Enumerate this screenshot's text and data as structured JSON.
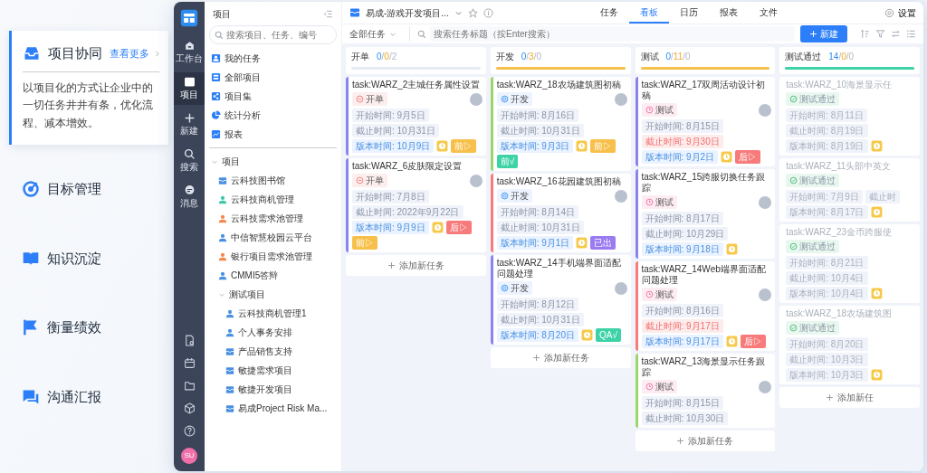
{
  "features": [
    {
      "title": "项目协同",
      "selected": true,
      "link": "查看更多",
      "description": "以项目化的方式让企业中的一切任务井井有条，优化流程、减本增效。"
    },
    {
      "title": "目标管理",
      "selected": false
    },
    {
      "title": "知识沉淀",
      "selected": false
    },
    {
      "title": "衡量绩效",
      "selected": false
    },
    {
      "title": "沟通汇报",
      "selected": false
    }
  ],
  "app": {
    "sidebar": {
      "items": [
        {
          "label": "工作台",
          "selected": false
        },
        {
          "label": "项目",
          "selected": true
        },
        {
          "label": "新建",
          "selected": false
        },
        {
          "label": "搜索",
          "selected": false
        },
        {
          "label": "消息",
          "selected": false
        }
      ],
      "avatar": "SU"
    },
    "project_panel": {
      "title": "项目",
      "search": {
        "placeholder": "搜索项目、任务、编号"
      },
      "nav": [
        {
          "label": "我的任务"
        },
        {
          "label": "全部项目"
        },
        {
          "label": "项目集"
        },
        {
          "label": "统计分析"
        },
        {
          "label": "报表"
        }
      ],
      "tree": [
        {
          "label": "项目",
          "expanded": true,
          "children": [
            {
              "label": "云科技图书馆",
              "kind": "box",
              "color": "#4a90e2"
            },
            {
              "label": "云科技商机管理",
              "kind": "person",
              "color": "#3cc8a8"
            },
            {
              "label": "云科技需求池管理",
              "kind": "person",
              "color": "#f5874f"
            },
            {
              "label": "中信智慧校园云平台",
              "kind": "person",
              "color": "#4a90e2"
            },
            {
              "label": "银行项目需求池管理",
              "kind": "person",
              "color": "#f5874f"
            },
            {
              "label": "CMMI5答辩",
              "kind": "person",
              "color": "#4a90e2"
            },
            {
              "label": "测试项目",
              "expanded": true,
              "children": [
                {
                  "label": "云科技商机管理1",
                  "kind": "person",
                  "color": "#4a90e2"
                },
                {
                  "label": "个人事务安排",
                  "kind": "person",
                  "color": "#4a90e2"
                },
                {
                  "label": "产品销售支持",
                  "kind": "box",
                  "color": "#4a90e2"
                },
                {
                  "label": "敏捷需求项目",
                  "kind": "box",
                  "color": "#4a90e2"
                },
                {
                  "label": "敏捷开发项目",
                  "kind": "box",
                  "color": "#4a90e2"
                },
                {
                  "label": "易成Project Risk Ma...",
                  "kind": "box",
                  "color": "#4a90e2"
                }
              ]
            }
          ]
        }
      ]
    },
    "project_title": "易成-游戏开发项目...",
    "tabs": [
      {
        "label": "任务",
        "selected": false
      },
      {
        "label": "看板",
        "selected": true
      },
      {
        "label": "日历",
        "selected": false
      },
      {
        "label": "报表",
        "selected": false
      },
      {
        "label": "文件",
        "selected": false
      }
    ],
    "settings": "设置",
    "filter": "全部任务",
    "search": {
      "placeholder": "搜索任务标题（按Enter搜索）"
    },
    "new_button": "新建",
    "columns": [
      {
        "title": "开单",
        "counts": [
          "0",
          "/",
          "0",
          "/",
          "2"
        ],
        "level": 0,
        "color": "#e6ebf3",
        "add": "添加新任务",
        "cards": [
          {
            "title": "task:WARZ_2主城任务属性设置",
            "color": "#8b84f0",
            "done": false,
            "status": {
              "kind": "open",
              "label": "开单"
            },
            "avatar": true,
            "chips": [
              {
                "kind": "plain",
                "text": "开始时间: 9月5日"
              },
              {
                "kind": "plain",
                "text": "截止时间: 10月31日"
              },
              {
                "kind": "version",
                "text": "版本时间: 10月9日"
              }
            ],
            "clock": true,
            "tags": [
              {
                "text": "前▷",
                "color": "#f7c04a"
              }
            ]
          },
          {
            "title": "task:WARZ_6皮肤限定设置",
            "color": "#8b84f0",
            "done": false,
            "status": {
              "kind": "open",
              "label": "开单"
            },
            "avatar": true,
            "chips": [
              {
                "kind": "plain",
                "text": "开始时间: 7月8日"
              },
              {
                "kind": "plain",
                "text": "截止时间: 2022年9月22日"
              },
              {
                "kind": "version",
                "text": "版本时间: 9月9日"
              }
            ],
            "clock": true,
            "tags": [
              {
                "text": "后▷",
                "color": "#f77b7b"
              },
              {
                "text": "前▷",
                "color": "#f7c04a"
              }
            ]
          }
        ]
      },
      {
        "title": "开发",
        "counts": [
          "0",
          "/",
          "3",
          "/",
          "0"
        ],
        "level": 1,
        "color": "#f7c04a",
        "add": "添加新任务",
        "cards": [
          {
            "title": "task:WARZ_18农场建筑图初稿",
            "color": "#9ad66a",
            "done": false,
            "status": {
              "kind": "dev",
              "label": "开发"
            },
            "avatar": true,
            "chips": [
              {
                "kind": "plain",
                "text": "开始时间: 8月16日"
              },
              {
                "kind": "plain",
                "text": "截止时间: 10月31日"
              },
              {
                "kind": "version",
                "text": "版本时间: 9月3日"
              }
            ],
            "clock": true,
            "tags": [
              {
                "text": "前▷",
                "color": "#f7c04a"
              },
              {
                "text": "前√",
                "color": "#3dd3a6"
              }
            ]
          },
          {
            "title": "task:WARZ_16花园建筑图初稿",
            "color": "#f77b7b",
            "done": false,
            "status": {
              "kind": "dev",
              "label": "开发"
            },
            "avatar": true,
            "chips": [
              {
                "kind": "plain",
                "text": "开始时间: 8月14日"
              },
              {
                "kind": "plain",
                "text": "截止时间: 10月31日"
              },
              {
                "kind": "version",
                "text": "版本时间: 9月1日"
              }
            ],
            "clock": true,
            "tags": [
              {
                "text": "已出",
                "color": "#9b7cf0"
              }
            ]
          },
          {
            "title": "task:WARZ_14手机端界面适配问题处理",
            "color": "#8b84f0",
            "done": false,
            "status": {
              "kind": "dev",
              "label": "开发"
            },
            "avatar": true,
            "chips": [
              {
                "kind": "plain",
                "text": "开始时间: 8月12日"
              },
              {
                "kind": "plain",
                "text": "截止时间: 10月31日"
              },
              {
                "kind": "version",
                "text": "版本时间: 8月20日"
              }
            ],
            "clock": true,
            "tags": [
              {
                "text": "QA√",
                "color": "#3dd3a6"
              }
            ]
          }
        ]
      },
      {
        "title": "测试",
        "counts": [
          "0",
          "/",
          "11",
          "/",
          "0"
        ],
        "level": 1,
        "color": "#f7c04a",
        "add": "添加新任务",
        "cards": [
          {
            "title": "task:WARZ_17双周活动设计初稿",
            "color": "#8b84f0",
            "done": false,
            "status": {
              "kind": "test",
              "label": "测试"
            },
            "avatar": true,
            "chips": [
              {
                "kind": "plain",
                "text": "开始时间: 8月15日"
              },
              {
                "kind": "overdue",
                "text": "截止时间: 9月30日"
              },
              {
                "kind": "version",
                "text": "版本时间: 9月2日"
              }
            ],
            "clock": true,
            "tags": [
              {
                "text": "后▷",
                "color": "#f77b7b"
              }
            ]
          },
          {
            "title": "task:WARZ_15跨服切换任务跟踪",
            "color": "#8b84f0",
            "done": false,
            "status": {
              "kind": "test",
              "label": "测试"
            },
            "avatar": true,
            "chips": [
              {
                "kind": "plain",
                "text": "开始时间: 8月17日"
              },
              {
                "kind": "plain",
                "text": "截止时间: 10月29日"
              },
              {
                "kind": "version",
                "text": "版本时间: 9月18日"
              }
            ],
            "clock": true
          },
          {
            "title": "task:WARZ_14Web端界面适配问题处理",
            "color": "#f77b7b",
            "done": false,
            "status": {
              "kind": "test",
              "label": "测试"
            },
            "avatar": true,
            "chips": [
              {
                "kind": "plain",
                "text": "开始时间: 8月16日"
              },
              {
                "kind": "overdue",
                "text": "截止时间: 9月17日"
              },
              {
                "kind": "version",
                "text": "版本时间: 9月17日"
              }
            ],
            "clock": true,
            "tags": [
              {
                "text": "后▷",
                "color": "#f77b7b"
              }
            ]
          },
          {
            "title": "task:WARZ_13海景显示任务跟踪",
            "color": "#9ad66a",
            "done": false,
            "status": {
              "kind": "test",
              "label": "测试"
            },
            "avatar": true,
            "chips": [
              {
                "kind": "plain",
                "text": "开始时间: 8月15日"
              },
              {
                "kind": "plain",
                "text": "截止时间: 10月30日"
              }
            ],
            "clock": false
          }
        ]
      },
      {
        "title": "测试通过",
        "counts": [
          "14",
          "/",
          "0",
          "/",
          "0"
        ],
        "level": 1,
        "color": "#3dd3a6",
        "add": "添加新任",
        "cards": [
          {
            "title": "task:WARZ_10海景显示任",
            "color": "#ffffff",
            "done": true,
            "status": {
              "kind": "passed",
              "label": "测试通过"
            },
            "avatar": false,
            "chips": [
              {
                "kind": "plain",
                "text": "开始时间: 8月11日"
              },
              {
                "kind": "plain",
                "text": "截止时间: 8月19日"
              },
              {
                "kind": "plain",
                "text": "版本时间: 8月19日"
              }
            ],
            "clock": true
          },
          {
            "title": "task:WARZ_11头部中英文",
            "color": "#ffffff",
            "done": true,
            "status": {
              "kind": "passed",
              "label": "测试通过"
            },
            "avatar": false,
            "chips": [
              {
                "kind": "plain",
                "text": "开始时间: 7月9日"
              },
              {
                "kind": "plain",
                "text": "截止时"
              },
              {
                "kind": "plain",
                "text": "版本时间: 8月17日"
              }
            ],
            "clock": true
          },
          {
            "title": "task:WARZ_23金币跨服使",
            "color": "#ffffff",
            "done": true,
            "status": {
              "kind": "passed",
              "label": "测试通过"
            },
            "avatar": false,
            "chips": [
              {
                "kind": "plain",
                "text": "开始时间: 8月21日"
              },
              {
                "kind": "plain",
                "text": "截止时间: 10月4日"
              },
              {
                "kind": "plain",
                "text": "版本时间: 10月4日"
              }
            ],
            "clock": true
          },
          {
            "title": "task:WARZ_18农场建筑图",
            "color": "#ffffff",
            "done": true,
            "status": {
              "kind": "passed",
              "label": "测试通过"
            },
            "avatar": false,
            "chips": [
              {
                "kind": "plain",
                "text": "开始时间: 8月20日"
              },
              {
                "kind": "plain",
                "text": "截止时间: 10月3日"
              },
              {
                "kind": "plain",
                "text": "版本时间: 10月3日"
              }
            ],
            "clock": true
          }
        ]
      }
    ]
  }
}
